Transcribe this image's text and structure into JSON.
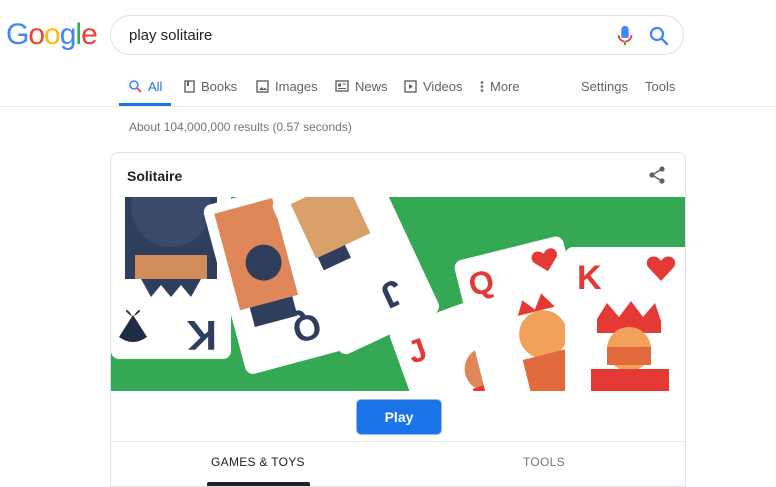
{
  "logo": {
    "letters": [
      "G",
      "o",
      "o",
      "g",
      "l",
      "e"
    ],
    "colors": [
      "#4285f4",
      "#ea4335",
      "#fbbc05",
      "#4285f4",
      "#34a853",
      "#ea4335"
    ]
  },
  "search": {
    "value": "play solitaire"
  },
  "tabs": [
    {
      "label": "All",
      "icon": "search-icon",
      "active": true
    },
    {
      "label": "Books",
      "icon": "book-icon"
    },
    {
      "label": "Images",
      "icon": "image-icon"
    },
    {
      "label": "News",
      "icon": "news-icon"
    },
    {
      "label": "Videos",
      "icon": "play-icon"
    },
    {
      "label": "More",
      "icon": "more-vert-icon"
    }
  ],
  "tools": {
    "settings": "Settings",
    "tools": "Tools"
  },
  "stats": "About 104,000,000 results (0.57 seconds)",
  "card": {
    "title": "Solitaire",
    "play_label": "Play",
    "tab_games": "GAMES & TOYS",
    "tab_tools": "TOOLS",
    "cards": {
      "q": "Q",
      "k": "K",
      "j": "J"
    },
    "colors": {
      "felt": "#34a853",
      "accent": "#1a73e8",
      "red": "#e53935",
      "navy": "#283a5a"
    }
  }
}
